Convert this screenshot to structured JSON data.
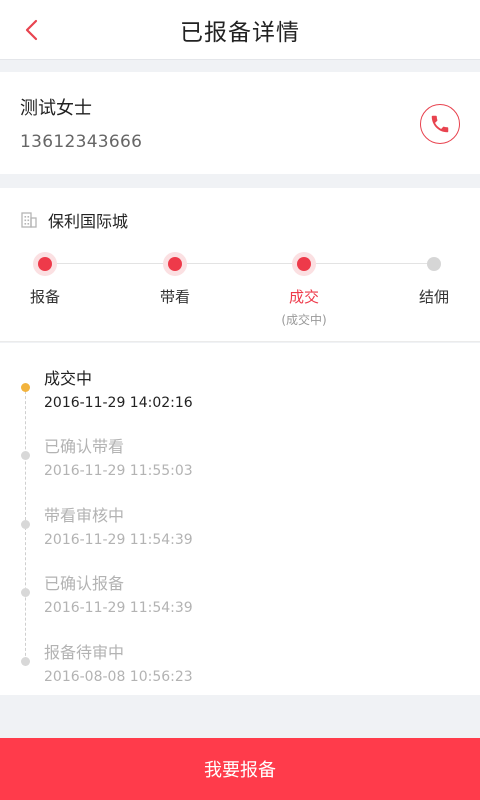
{
  "header": {
    "title": "已报备详情",
    "back_icon": "chevron-left-icon"
  },
  "contact": {
    "name": "测试女士",
    "phone": "13612343666",
    "call_icon": "phone-icon"
  },
  "project": {
    "icon": "building-icon",
    "name": "保利国际城"
  },
  "steps": [
    {
      "label": "报备",
      "sub": "",
      "status": "done"
    },
    {
      "label": "带看",
      "sub": "",
      "status": "done"
    },
    {
      "label": "成交",
      "sub": "(成交中)",
      "status": "current"
    },
    {
      "label": "结佣",
      "sub": "",
      "status": "pending"
    }
  ],
  "timeline": [
    {
      "title": "成交中",
      "time": "2016-11-29 14:02:16"
    },
    {
      "title": "已确认带看",
      "time": "2016-11-29 11:55:03"
    },
    {
      "title": "带看审核中",
      "time": "2016-11-29 11:54:39"
    },
    {
      "title": "已确认报备",
      "time": "2016-11-29 11:54:39"
    },
    {
      "title": "报备待审中",
      "time": "2016-08-08 10:56:23"
    }
  ],
  "bottom_button": {
    "label": "我要报备"
  },
  "colors": {
    "accent": "#ee3a4a",
    "button": "#ff3b4b",
    "timeline_active": "#f2b33d",
    "inactive": "#d6d6d6"
  }
}
